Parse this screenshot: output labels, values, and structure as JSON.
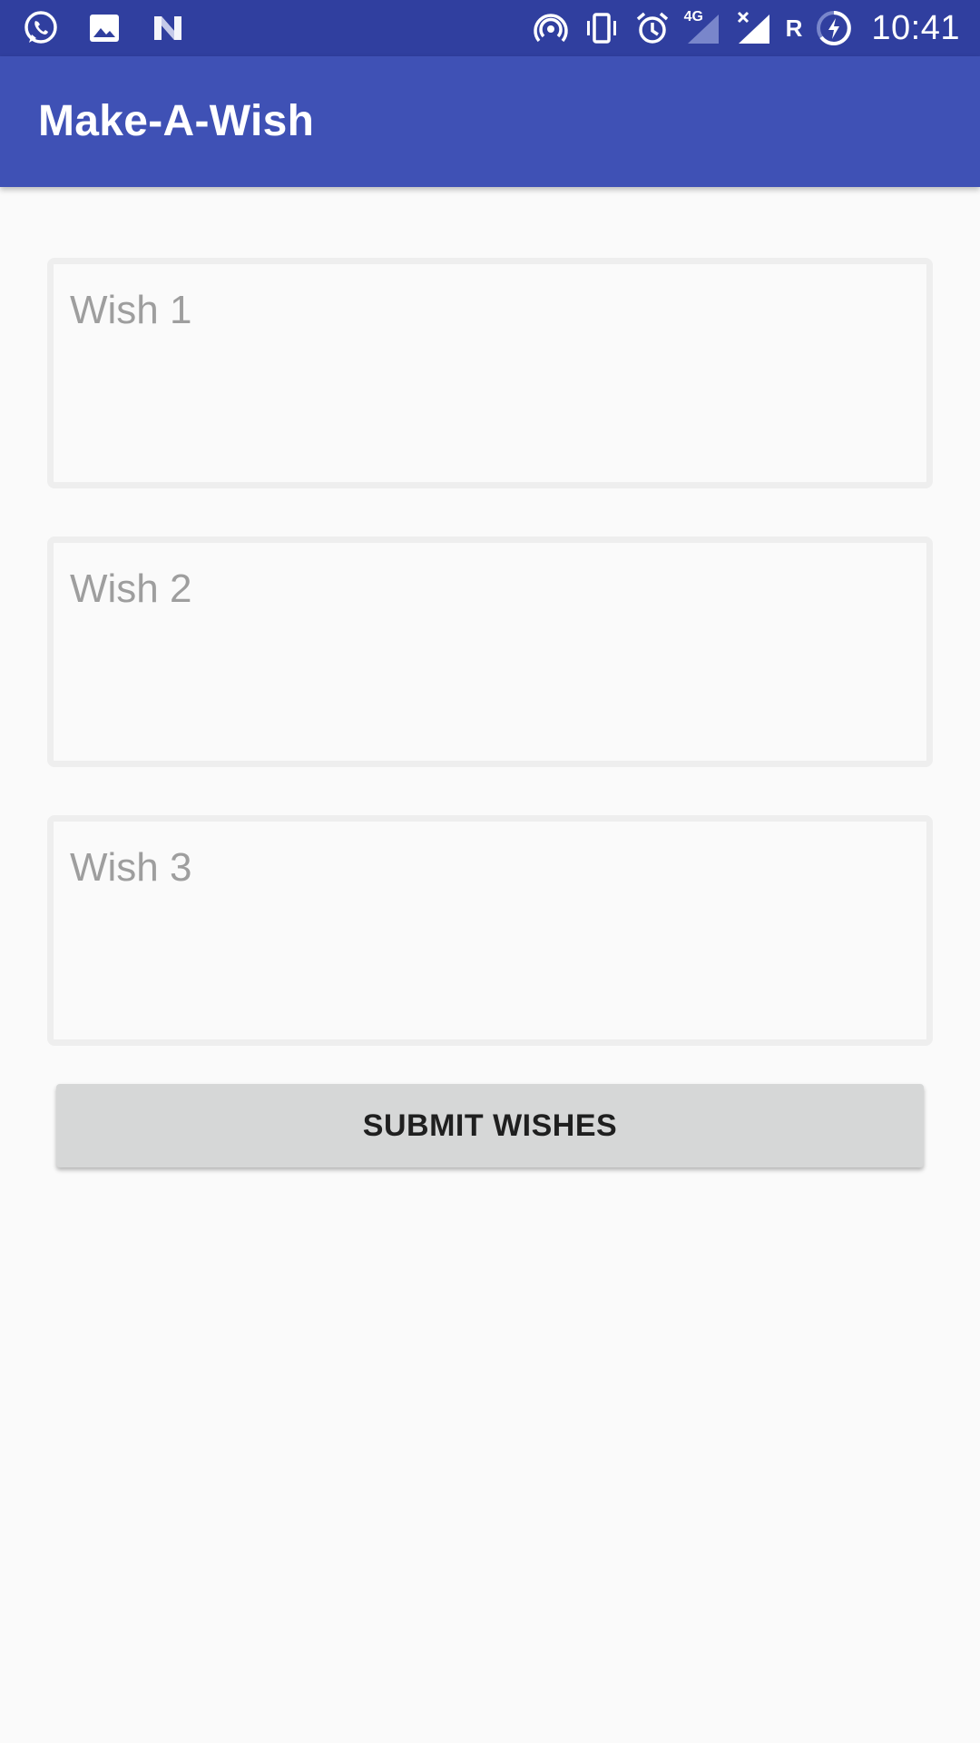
{
  "status_bar": {
    "time": "10:41",
    "network_label": "4G",
    "roaming_label": "R",
    "left_icons": [
      "whatsapp-icon",
      "image-icon",
      "n-icon"
    ],
    "right_icons": [
      "hotspot-icon",
      "vibrate-icon",
      "alarm-icon",
      "signal-4g-icon",
      "signal-no-data-icon",
      "battery-charging-icon"
    ],
    "background_color": "#303f9f"
  },
  "app_bar": {
    "title": "Make-A-Wish",
    "background_color": "#3f51b5"
  },
  "form": {
    "wish_1": {
      "placeholder": "Wish 1",
      "value": ""
    },
    "wish_2": {
      "placeholder": "Wish 2",
      "value": ""
    },
    "wish_3": {
      "placeholder": "Wish 3",
      "value": ""
    },
    "submit_label": "SUBMIT WISHES"
  }
}
